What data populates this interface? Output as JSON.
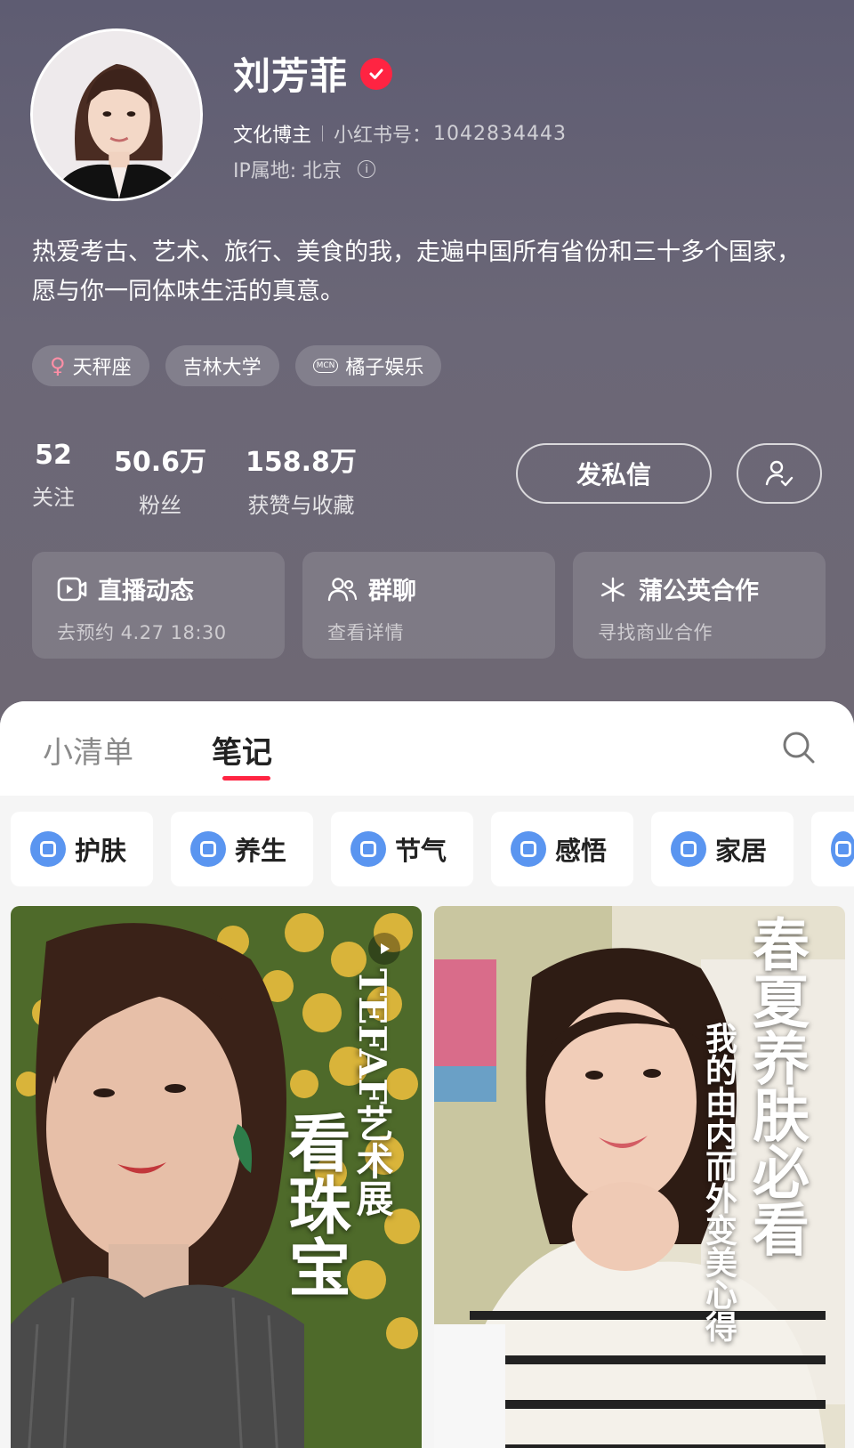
{
  "profile": {
    "name": "刘芳菲",
    "role": "文化博主",
    "id_label": "小红书号：",
    "id_value": "1042834443",
    "ip": "IP属地: 北京",
    "bio": "热爱考古、艺术、旅行、美食的我，走遍中国所有省份和三十多个国家，愿与你一同体味生活的真意。",
    "tags": [
      "天秤座",
      "吉林大学",
      "橘子娱乐"
    ],
    "mcn_badge": "MCN"
  },
  "stats": [
    {
      "num": "52",
      "label": "关注"
    },
    {
      "num": "50.6万",
      "label": "粉丝"
    },
    {
      "num": "158.8万",
      "label": "获赞与收藏"
    }
  ],
  "actions": {
    "message": "发私信"
  },
  "cards": [
    {
      "title": "直播动态",
      "sub": "去预约 4.27 18:30",
      "icon": "live-icon"
    },
    {
      "title": "群聊",
      "sub": "查看详情",
      "icon": "group-icon"
    },
    {
      "title": "蒲公英合作",
      "sub": "寻找商业合作",
      "icon": "dandelion-icon"
    }
  ],
  "tabs": [
    {
      "label": "小清单"
    },
    {
      "label": "笔记"
    }
  ],
  "chips": [
    "护肤",
    "养生",
    "节气",
    "感悟",
    "家居"
  ],
  "posts": [
    {
      "overlay_a": "TEFAF艺术展",
      "overlay_b": "看珠宝"
    },
    {
      "overlay_a": "春夏养肤必看",
      "overlay_b": "我的由内而外变美心得"
    }
  ],
  "colors": {
    "accent": "#ff2442",
    "chip_icon": "#5a95f0",
    "header_bg": "#66637a"
  }
}
